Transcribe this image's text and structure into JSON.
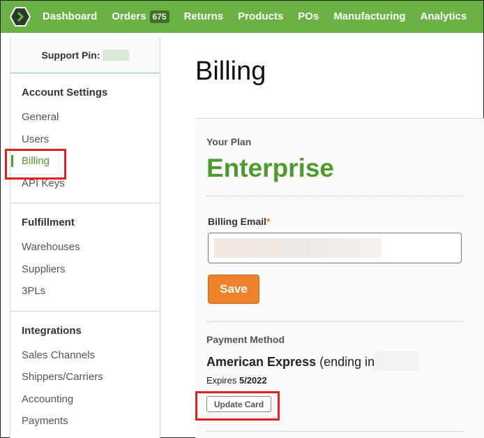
{
  "nav": {
    "items": [
      {
        "label": "Dashboard"
      },
      {
        "label": "Orders",
        "badge": "675"
      },
      {
        "label": "Returns"
      },
      {
        "label": "Products"
      },
      {
        "label": "POs"
      },
      {
        "label": "Manufacturing"
      },
      {
        "label": "Analytics"
      }
    ]
  },
  "sidebar": {
    "support_pin_label": "Support Pin:",
    "sections": [
      {
        "heading": "Account Settings",
        "items": [
          "General",
          "Users",
          "Billing",
          "API Keys"
        ]
      },
      {
        "heading": "Fulfillment",
        "items": [
          "Warehouses",
          "Suppliers",
          "3PLs"
        ]
      },
      {
        "heading": "Integrations",
        "items": [
          "Sales Channels",
          "Shippers/Carriers",
          "Accounting",
          "Payments"
        ]
      }
    ],
    "active_item": "Billing"
  },
  "main": {
    "title": "Billing",
    "plan_label": "Your Plan",
    "plan_name": "Enterprise",
    "email_label": "Billing Email",
    "email_required_mark": "*",
    "save_label": "Save",
    "payment_label": "Payment Method",
    "card_brand": "American Express",
    "card_ending_text": "(ending in",
    "expires_label": "Expires",
    "expires_value": "5/2022",
    "update_card_label": "Update Card"
  },
  "colors": {
    "brand_green": "#6ab245",
    "accent_green": "#4e9a2c",
    "save_orange": "#f0812b",
    "highlight_red": "#e0201c"
  }
}
